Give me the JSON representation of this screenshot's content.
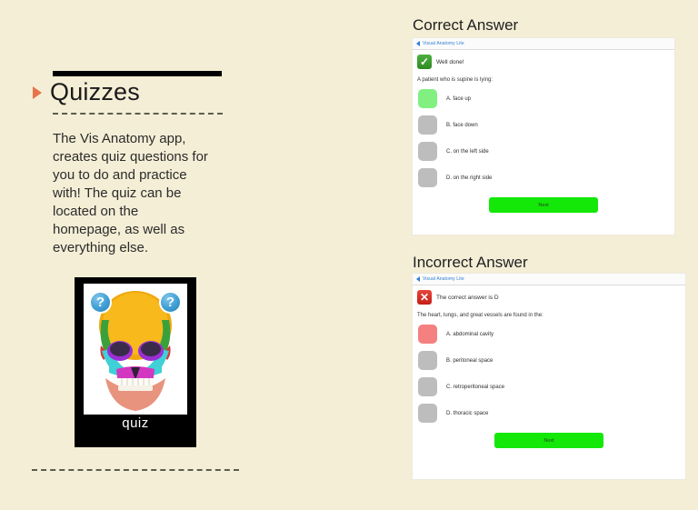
{
  "slide": {
    "background_color": "#f4eed6",
    "accent_color": "#e8744d"
  },
  "left": {
    "heading": "Quizzes",
    "body": "The Vis Anatomy app, creates quiz questions for you to do and practice with! The quiz can be located on the homepage, as well as everything else.",
    "tile": {
      "caption": "quiz",
      "question_mark_left": "?",
      "question_mark_right": "?"
    }
  },
  "correct_panel": {
    "title": "Correct Answer",
    "nav": {
      "back_label": "Visual Anatomy Lite"
    },
    "result": {
      "icon": "check-icon",
      "text": "Well done!",
      "color": "#2f8a22"
    },
    "question": "A patient who is supine is lying:",
    "options": [
      {
        "label": "A.  face up",
        "state": "correct"
      },
      {
        "label": "B.  face down",
        "state": "neutral"
      },
      {
        "label": "C.  on the left side",
        "state": "neutral"
      },
      {
        "label": "D.  on the right side",
        "state": "neutral"
      }
    ],
    "next_label": "Next"
  },
  "incorrect_panel": {
    "title": "Incorrect Answer",
    "nav": {
      "back_label": "Visual Anatomy Lite"
    },
    "result": {
      "icon": "cross-icon",
      "text": "The correct answer is D",
      "color": "#c41f17"
    },
    "question": "The heart, lungs, and great vessels are found in the:",
    "options": [
      {
        "label": "A.  abdominal cavity",
        "state": "wrong"
      },
      {
        "label": "B.  peritoneal space",
        "state": "neutral"
      },
      {
        "label": "C.  retroperitoneal space",
        "state": "neutral"
      },
      {
        "label": "D.  thoracic space",
        "state": "neutral"
      }
    ],
    "next_label": "Next"
  }
}
